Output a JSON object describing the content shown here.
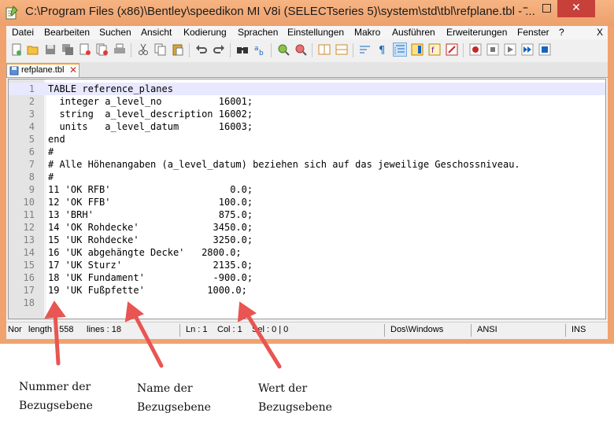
{
  "window": {
    "title": "C:\\Program Files (x86)\\Bentley\\speedikon MI V8i (SELECTseries 5)\\system\\std\\tbl\\refplane.tbl - ...",
    "minimize": "–",
    "maximize": "□",
    "close": "✕"
  },
  "menu": [
    "Datei",
    "Bearbeiten",
    "Suchen",
    "Ansicht",
    "Kodierung",
    "Sprachen",
    "Einstellungen",
    "Makro",
    "Ausführen",
    "Erweiterungen",
    "Fenster",
    "?"
  ],
  "menu_close": "X",
  "toolbar": {
    "icons": [
      "new-file-icon",
      "open-file-icon",
      "save-icon",
      "save-all-icon",
      "close-icon",
      "close-all-icon",
      "print-icon",
      "cut-icon",
      "copy-icon",
      "paste-icon",
      "undo-icon",
      "redo-icon",
      "find-icon",
      "replace-icon",
      "zoom-in-icon",
      "zoom-out-icon",
      "sync-vertical-icon",
      "sync-horizontal-icon",
      "word-wrap-icon",
      "show-all-characters-icon",
      "indent-guide-icon",
      "document-map-icon",
      "function-list-icon",
      "folder-workspace-icon",
      "record-macro-icon",
      "stop-macro-icon",
      "play-macro-icon",
      "run-macro-multiple-icon",
      "save-macro-icon"
    ],
    "active": [
      "indent-guide-icon"
    ]
  },
  "tab": {
    "label": "refplane.tbl",
    "close": "✕"
  },
  "editor": {
    "current_line": 1,
    "lines": [
      "TABLE reference_planes",
      "  integer a_level_no          16001;",
      "  string  a_level_description 16002;",
      "  units   a_level_datum       16003;",
      "end",
      "#",
      "# Alle Höhenangaben (a_level_datum) beziehen sich auf das jeweilige Geschossniveau.",
      "#",
      "11 'OK RFB'                     0.0;",
      "12 'OK FFB'                   100.0;",
      "13 'BRH'                      875.0;",
      "14 'OK Rohdecke'             3450.0;",
      "15 'UK Rohdecke'             3250.0;",
      "16 'UK abgehängte Decke'   2800.0;",
      "17 'UK Sturz'                2135.0;",
      "18 'UK Fundament'            -900.0;",
      "19 'UK Fußpfette'           1000.0;",
      ""
    ]
  },
  "status": {
    "type": "Nor",
    "length": "length : 558",
    "lines": "lines : 18",
    "ln": "Ln : 1",
    "col": "Col : 1",
    "sel": "Sel : 0 | 0",
    "eol": "Dos\\Windows",
    "encoding": "ANSI",
    "mode": "INS"
  },
  "annotations": [
    {
      "line1": "Nummer der",
      "line2": "Bezugsebene"
    },
    {
      "line1": "Name der",
      "line2": "Bezugsebene"
    },
    {
      "line1": "Wert der",
      "line2": "Bezugsebene"
    }
  ],
  "colors": {
    "title_bar": "#f0a36f",
    "close_button": "#c7403a",
    "arrow": "#e85552",
    "line_numbers": "#808080",
    "current_line": "#e8e8ff"
  }
}
